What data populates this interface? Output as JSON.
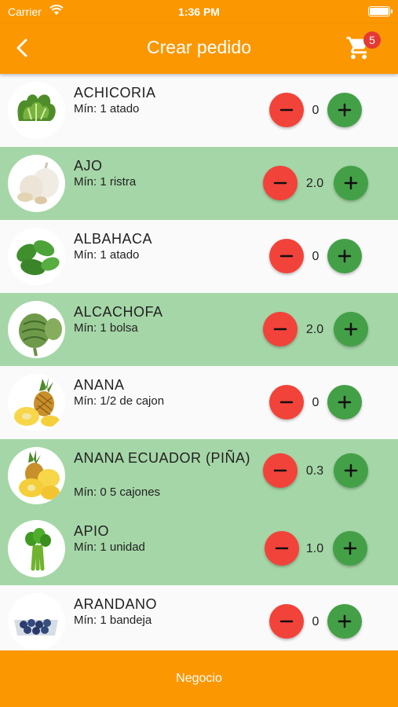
{
  "status": {
    "carrier": "Carrier",
    "time": "1:36 PM"
  },
  "header": {
    "title": "Crear pedido",
    "cart_count": "5",
    "back_icon": "back-arrow-icon",
    "cart_icon": "cart-icon"
  },
  "colors": {
    "primary": "#fb9701",
    "selected_row": "#a5d6a7",
    "minus": "#f2433a",
    "plus": "#43a047",
    "badge": "#e53935"
  },
  "products": [
    {
      "name": "ACHICORIA",
      "min": "Mín: 1 atado",
      "qty": "0",
      "selected": false,
      "image": "chicory"
    },
    {
      "name": "AJO",
      "min": "Mín: 1 ristra",
      "qty": "2.0",
      "selected": true,
      "image": "garlic"
    },
    {
      "name": "ALBAHACA",
      "min": "Mín: 1 atado",
      "qty": "0",
      "selected": false,
      "image": "basil"
    },
    {
      "name": "ALCACHOFA",
      "min": "Mín: 1 bolsa",
      "qty": "2.0",
      "selected": true,
      "image": "artichoke"
    },
    {
      "name": "ANANA",
      "min": "Mín: 1/2 de cajon",
      "qty": "0",
      "selected": false,
      "image": "pineapple"
    },
    {
      "name": "ANANA ECUADOR (PIÑA)",
      "min": "Mín: 0 5 cajones",
      "qty": "0.3",
      "selected": true,
      "image": "pineapple-slices"
    },
    {
      "name": "APIO",
      "min": "Mín: 1 unidad",
      "qty": "1.0",
      "selected": true,
      "image": "celery"
    },
    {
      "name": "ARANDANO",
      "min": "Mín: 1 bandeja",
      "qty": "0",
      "selected": false,
      "image": "blueberries"
    }
  ],
  "footer": {
    "label": "Negocio"
  }
}
